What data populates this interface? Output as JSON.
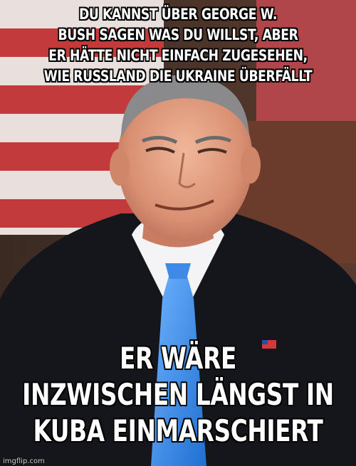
{
  "meme": {
    "top_text_lines": [
      "DU KANNST ÜBER GEORGE W.",
      "BUSH SAGEN WAS DU WILLST, ABER",
      "ER HÄTTE NICHT EINFACH ZUGESEHEN,",
      "WIE RUSSLAND DIE UKRAINE ÜBERFÄLLT"
    ],
    "bottom_text_lines": [
      "ER WÄRE",
      "INZWISCHEN LÄNGST IN",
      "KUBA EINMARSCHIERT"
    ],
    "watermark": "imgflip.com"
  }
}
